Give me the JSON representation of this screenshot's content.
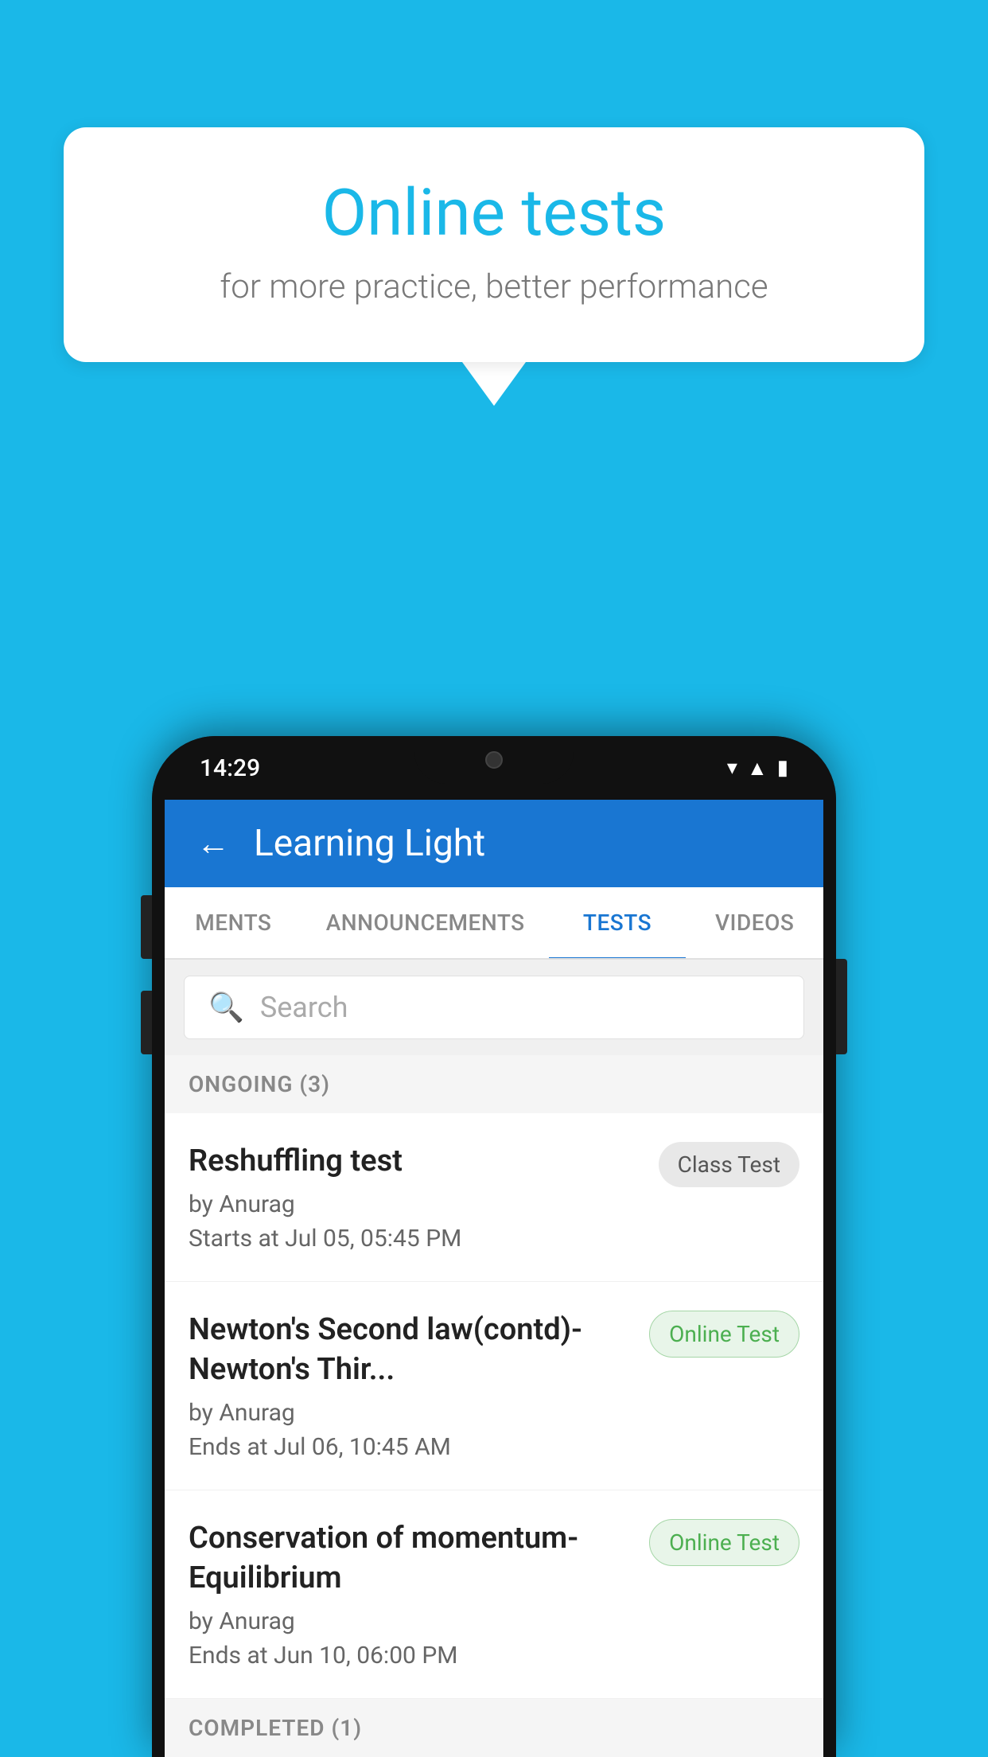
{
  "background_color": "#1ab8e8",
  "speech_bubble": {
    "title": "Online tests",
    "subtitle": "for more practice, better performance"
  },
  "phone": {
    "time": "14:29",
    "status_icons": [
      "wifi",
      "signal",
      "battery"
    ]
  },
  "app": {
    "title": "Learning Light",
    "back_label": "←"
  },
  "tabs": [
    {
      "label": "MENTS",
      "active": false
    },
    {
      "label": "ANNOUNCEMENTS",
      "active": false
    },
    {
      "label": "TESTS",
      "active": true
    },
    {
      "label": "VIDEOS",
      "active": false
    }
  ],
  "search": {
    "placeholder": "Search"
  },
  "sections": {
    "ongoing": {
      "label": "ONGOING (3)",
      "tests": [
        {
          "name": "Reshuffling test",
          "author": "by Anurag",
          "date": "Starts at  Jul 05, 05:45 PM",
          "badge": "Class Test",
          "badge_type": "class"
        },
        {
          "name": "Newton's Second law(contd)-Newton's Thir...",
          "author": "by Anurag",
          "date": "Ends at  Jul 06, 10:45 AM",
          "badge": "Online Test",
          "badge_type": "online"
        },
        {
          "name": "Conservation of momentum-Equilibrium",
          "author": "by Anurag",
          "date": "Ends at  Jun 10, 06:00 PM",
          "badge": "Online Test",
          "badge_type": "online"
        }
      ]
    },
    "completed": {
      "label": "COMPLETED (1)"
    }
  }
}
